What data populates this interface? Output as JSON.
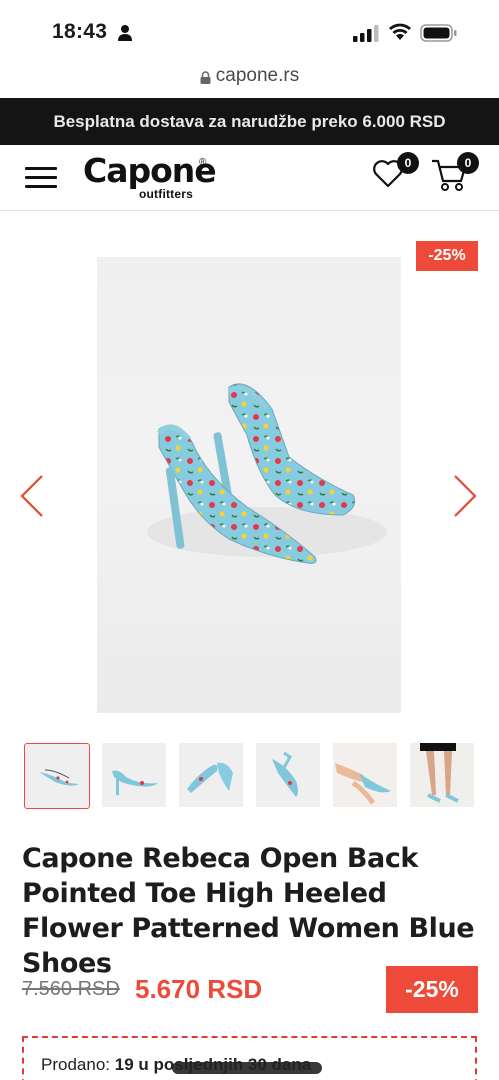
{
  "status_bar": {
    "time": "18:43",
    "icons": [
      "person-icon",
      "signal-icon",
      "wifi-icon",
      "battery-icon"
    ]
  },
  "browser": {
    "url": "capone.rs"
  },
  "promo_banner": {
    "text": "Besplatna dostava za narudžbe preko 6.000 RSD"
  },
  "header": {
    "logo_main": "Capone",
    "logo_sub": "outfitters",
    "logo_reg": "®",
    "wishlist_count": "0",
    "cart_count": "0"
  },
  "gallery": {
    "discount_badge": "-25%",
    "thumbnail_count": 6,
    "active_thumbnail": 1
  },
  "product": {
    "title": "Capone Rebeca Open Back Pointed Toe High Heeled Flower Patterned Women Blue Shoes",
    "old_price": "7.560 RSD",
    "new_price": "5.670 RSD",
    "discount": "-25%"
  },
  "sold": {
    "label": "Prodano:",
    "value": "19 u posljednjih 30 dana"
  },
  "colors": {
    "accent": "#ee4a39",
    "banner": "#141414",
    "shoe": "#7fc7d9"
  }
}
